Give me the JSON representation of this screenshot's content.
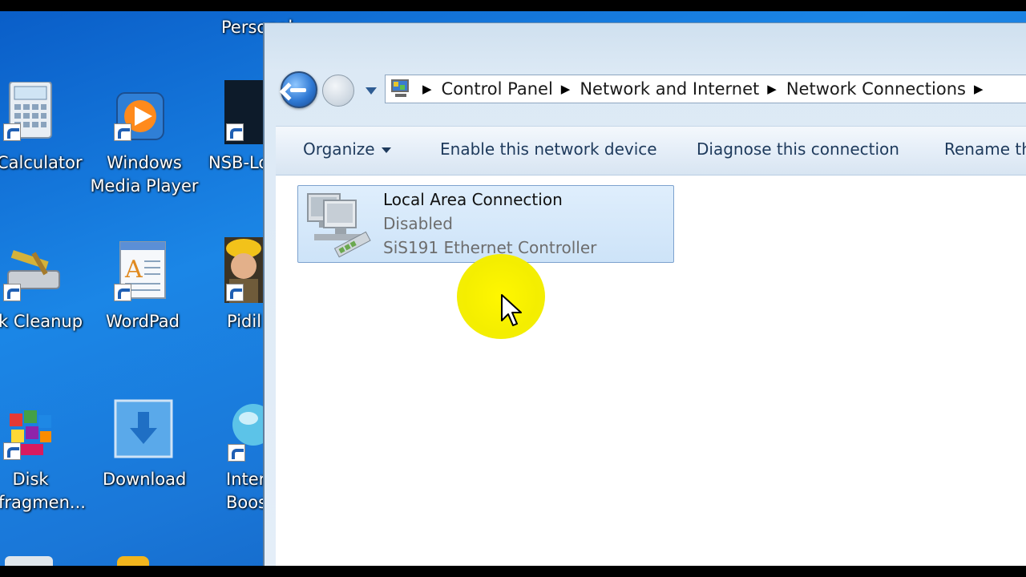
{
  "desktop": {
    "icons": [
      {
        "label": "Personal",
        "icon": "personal-folder-icon"
      },
      {
        "label": "Calculator",
        "icon": "calculator-icon"
      },
      {
        "label": "Windows\nMedia Player",
        "label_line1": "Windows",
        "label_line2": "Media Player",
        "icon": "media-player-icon"
      },
      {
        "label": "NSB-Lo",
        "icon": "nsb-app-icon"
      },
      {
        "label": "k Cleanup",
        "icon": "disk-cleanup-icon"
      },
      {
        "label": "WordPad",
        "icon": "wordpad-icon"
      },
      {
        "label": "Pidil",
        "icon": "pidil-app-icon"
      },
      {
        "label_line1": "Disk",
        "label_line2": "fragmen...",
        "icon": "disk-defragmenter-icon"
      },
      {
        "label": "Download",
        "icon": "download-folder-icon"
      },
      {
        "label_line1": "Inter",
        "label_line2": "Boos",
        "icon": "internet-booster-icon"
      }
    ]
  },
  "window": {
    "address_bar": {
      "icon": "control-panel-icon",
      "crumbs": [
        "Control Panel",
        "Network and Internet",
        "Network Connections"
      ]
    },
    "toolbar": {
      "organize_label": "Organize",
      "enable_label": "Enable this network device",
      "diagnose_label": "Diagnose this connection",
      "rename_label": "Rename th"
    },
    "connections": [
      {
        "name": "Local Area Connection",
        "status": "Disabled",
        "device": "SiS191 Ethernet Controller",
        "icon": "network-adapter-icon"
      }
    ]
  },
  "colors": {
    "desktop_blue": "#1a77d8",
    "selection_fill": "#cde3f8",
    "highlight_yellow": "#fff700"
  }
}
